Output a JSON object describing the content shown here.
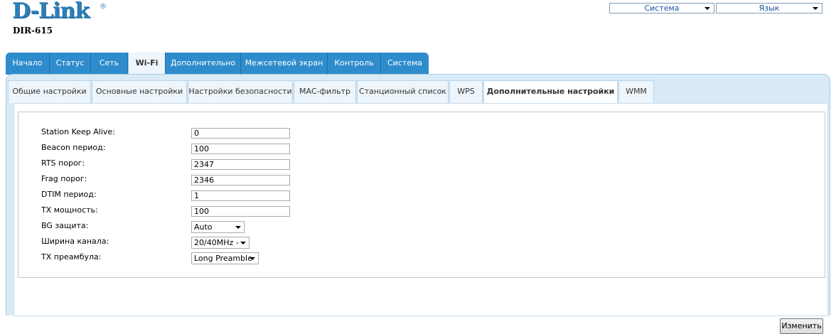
{
  "brand": {
    "logo": "D-Link",
    "reg_mark": "®",
    "model": "DIR-615"
  },
  "top_menu": {
    "system": "Система",
    "language": "Язык"
  },
  "main_tabs": [
    "Начало",
    "Статус",
    "Сеть",
    "Wi-Fi",
    "Дополнительно",
    "Межсетевой экран",
    "Контроль",
    "Система"
  ],
  "main_tab_active": "Wi-Fi",
  "sub_tabs": [
    "Общие настройки",
    "Основные настройки",
    "Настройки безопасности",
    "MAC-фильтр",
    "Станционный список",
    "WPS",
    "Дополнительные настройки",
    "WMM"
  ],
  "sub_tab_active": "Дополнительные настройки",
  "form": {
    "station_keep_alive": {
      "label": "Station Keep Alive:",
      "value": "0"
    },
    "beacon": {
      "label": "Beacon период:",
      "value": "100"
    },
    "rts": {
      "label": "RTS порог:",
      "value": "2347"
    },
    "frag": {
      "label": "Frag порог:",
      "value": "2346"
    },
    "dtim": {
      "label": "DTIM период:",
      "value": "1"
    },
    "tx_power": {
      "label": "TX мощность:",
      "value": "100"
    },
    "bg_protection": {
      "label": "BG защита:",
      "value": "Auto"
    },
    "channel_width": {
      "label": "Ширина канала:",
      "value": "20/40MHz -"
    },
    "tx_preamble": {
      "label": "TX преамбула:",
      "value": "Long Preamble"
    }
  },
  "apply_label": "Изменить",
  "colors": {
    "brand_blue": "#2c7fb8",
    "tab_bar": "#2f8ccc",
    "panel_bg": "#d9ebf7"
  }
}
